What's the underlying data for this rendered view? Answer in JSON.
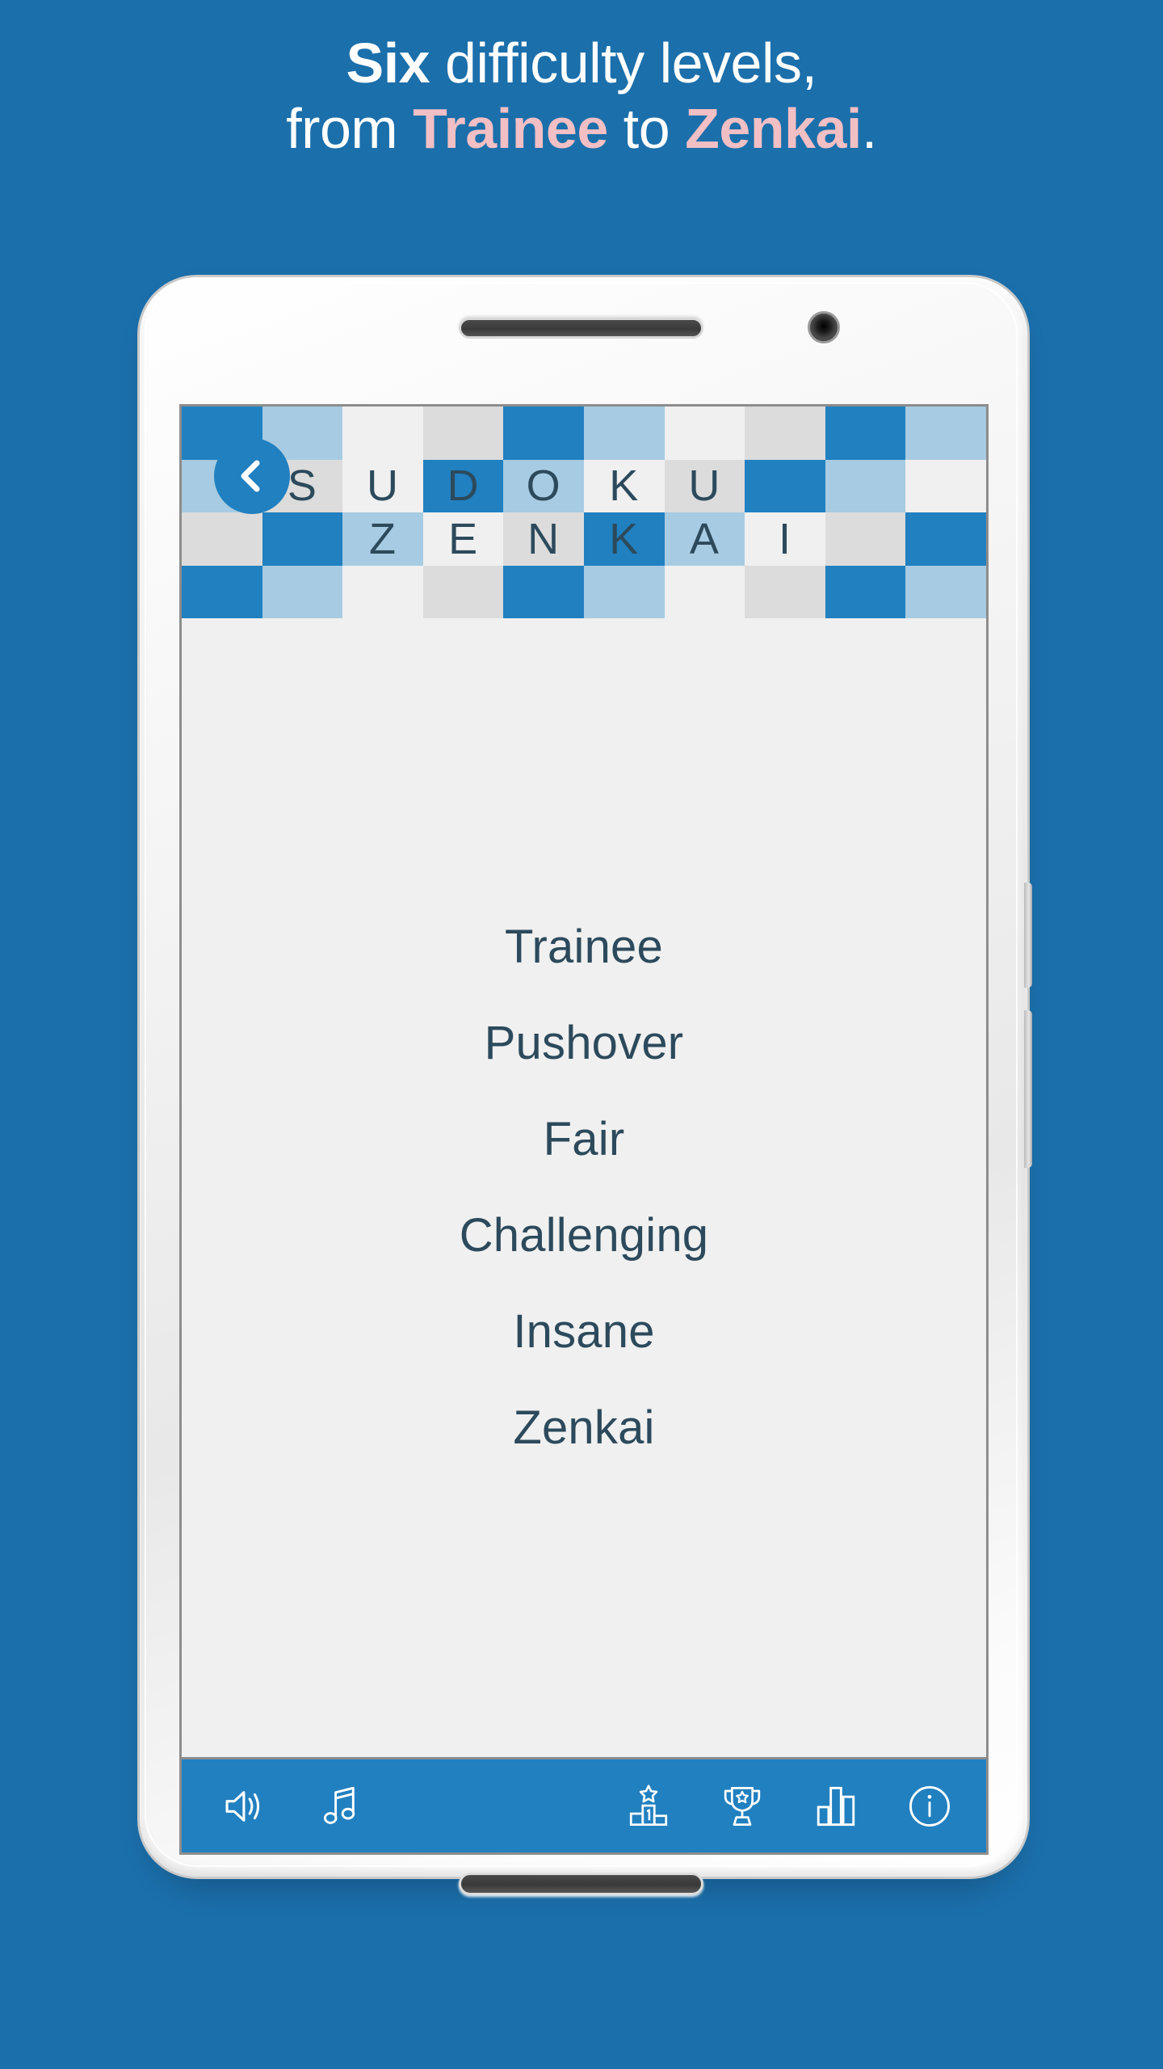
{
  "headline": {
    "line1_bold": "Six",
    "line1_rest": " difficulty levels,",
    "line2_a": "from ",
    "line2_b": "Trainee",
    "line2_c": " to ",
    "line2_d": "Zenkai",
    "line2_e": "."
  },
  "colors": {
    "background": "#1b6fab",
    "accent_blue": "#2180c0",
    "light_blue": "#a7cbe2",
    "gray_cell": "#dcdcdc",
    "white_cell": "#f0f0f0",
    "pink": "#f2bfc4",
    "text_dark": "#2c4a5c"
  },
  "app": {
    "title_row1": "SUDOKU",
    "title_row2": "ZENKAI",
    "back_button": "back-chevron",
    "mosaic": {
      "row1": [
        "blue",
        "lightblue",
        "white",
        "gray",
        "blue",
        "lightblue",
        "white",
        "gray",
        "blue",
        "lightblue"
      ],
      "row2": [
        "lightblue",
        "gray",
        "white",
        "blue",
        "lightblue",
        "white",
        "gray",
        "blue",
        "lightblue",
        "white"
      ],
      "row3": [
        "gray",
        "blue",
        "lightblue",
        "white",
        "gray",
        "blue",
        "lightblue",
        "white",
        "gray",
        "blue"
      ],
      "row4": [
        "blue",
        "lightblue",
        "white",
        "gray",
        "blue",
        "lightblue",
        "white",
        "gray",
        "blue",
        "lightblue"
      ],
      "letters_row2": [
        "",
        "S",
        "U",
        "D",
        "O",
        "K",
        "U",
        "",
        "",
        ""
      ],
      "letters_row3": [
        "",
        "",
        "Z",
        "E",
        "N",
        "K",
        "A",
        "I",
        "",
        ""
      ]
    },
    "levels": [
      {
        "label": "Trainee"
      },
      {
        "label": "Pushover"
      },
      {
        "label": "Fair"
      },
      {
        "label": "Challenging"
      },
      {
        "label": "Insane"
      },
      {
        "label": "Zenkai"
      }
    ],
    "bottom_bar": {
      "left": [
        {
          "icon": "sound-icon",
          "label": "Sound"
        },
        {
          "icon": "music-icon",
          "label": "Music"
        }
      ],
      "right": [
        {
          "icon": "podium-icon",
          "label": "Leaderboard"
        },
        {
          "icon": "trophy-icon",
          "label": "Achievements"
        },
        {
          "icon": "bar-chart-icon",
          "label": "Statistics"
        },
        {
          "icon": "info-icon",
          "label": "Info"
        }
      ]
    }
  },
  "device": {
    "earpiece": "earpiece-speaker",
    "camera": "front-camera",
    "home_bar": "bottom-speaker"
  }
}
